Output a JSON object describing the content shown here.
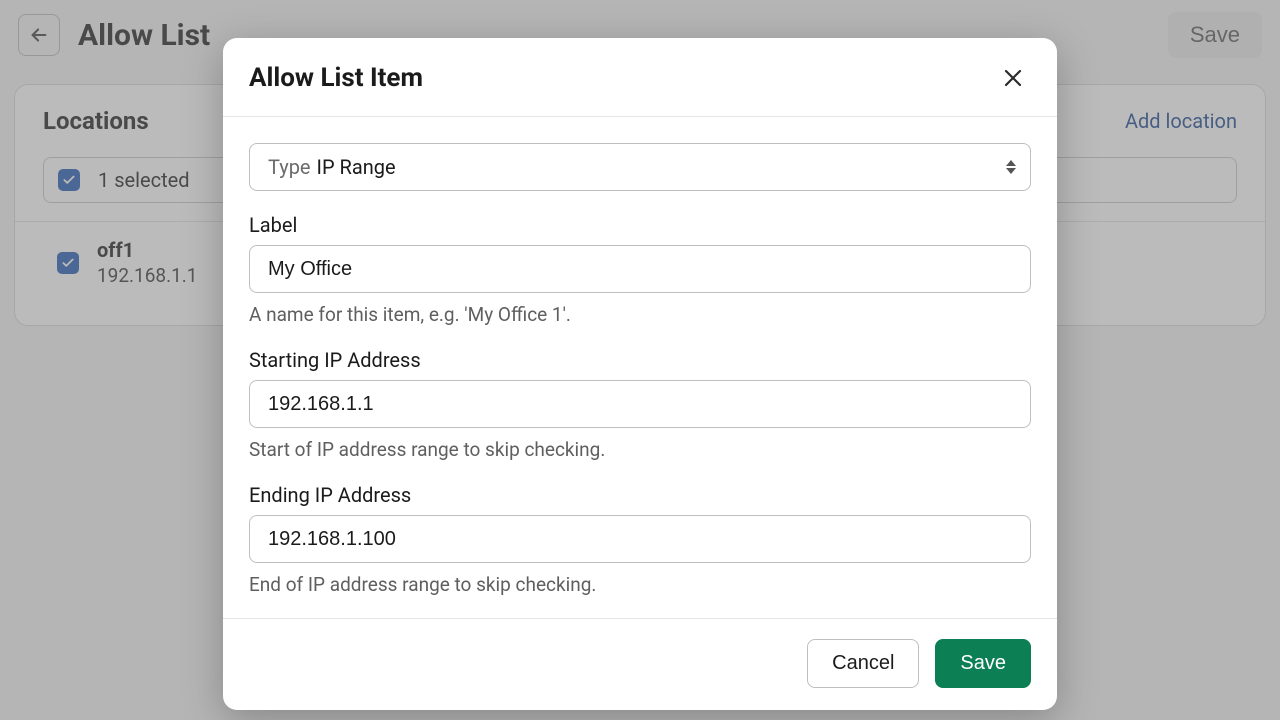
{
  "header": {
    "title": "Allow List",
    "save_label": "Save"
  },
  "locations": {
    "section_title": "Locations",
    "add_label": "Add location",
    "selected_text": "1 selected",
    "items": [
      {
        "name": "off1",
        "ip": "192.168.1.1",
        "checked": true
      }
    ]
  },
  "modal": {
    "title": "Allow List Item",
    "type_label": "Type",
    "type_value": "IP Range",
    "label_field": {
      "label": "Label",
      "value": "My Office",
      "hint": "A name for this item, e.g. 'My Office 1'."
    },
    "start_ip": {
      "label": "Starting IP Address",
      "value": "192.168.1.1",
      "hint": "Start of IP address range to skip checking."
    },
    "end_ip": {
      "label": "Ending IP Address",
      "value": "192.168.1.100",
      "hint": "End of IP address range to skip checking."
    },
    "cancel_label": "Cancel",
    "save_label": "Save"
  }
}
